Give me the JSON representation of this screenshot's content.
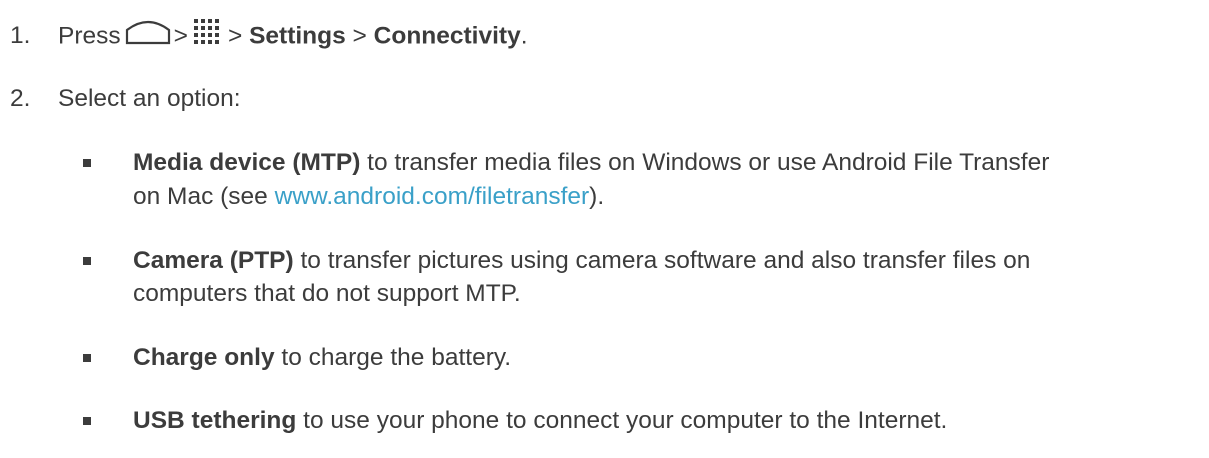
{
  "steps": [
    {
      "number": "1.",
      "press_label": "Press",
      "separator": ">",
      "home_icon": "home-button-icon",
      "apps_icon": "apps-grid-icon",
      "settings": "Settings",
      "connectivity": "Connectivity",
      "period": "."
    },
    {
      "number": "2.",
      "text": "Select an option:"
    }
  ],
  "options": [
    {
      "title": "Media device (MTP)",
      "line1": " to transfer media files on Windows or use Android File Transfer",
      "line2_prefix": "on Mac (see ",
      "link": "www.android.com/filetransfer",
      "line2_suffix": ")."
    },
    {
      "title": "Camera (PTP)",
      "line1": " to transfer pictures using camera software and also transfer files on",
      "line2": "computers that do not support MTP."
    },
    {
      "title": "Charge only",
      "line1": " to charge the battery."
    },
    {
      "title": "USB tethering",
      "line1": " to use your phone to connect your computer to the Internet."
    }
  ],
  "colors": {
    "text": "#3c3c3c",
    "link": "#3aa0c8"
  }
}
